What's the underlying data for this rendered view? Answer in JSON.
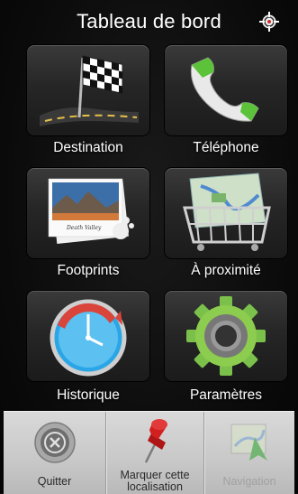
{
  "header": {
    "title": "Tableau de bord",
    "gps_icon": "crosshair-gps-icon"
  },
  "tiles": [
    {
      "label": "Destination",
      "icon": "checkered-flag-road-icon"
    },
    {
      "label": "Téléphone",
      "icon": "phone-handset-icon"
    },
    {
      "label": "Footprints",
      "icon": "photo-stack-icon"
    },
    {
      "label": "À proximité",
      "icon": "map-basket-icon"
    },
    {
      "label": "Historique",
      "icon": "clock-history-icon"
    },
    {
      "label": "Paramètres",
      "icon": "gear-settings-icon"
    }
  ],
  "bottom_bar": {
    "quit_label": "Quitter",
    "mark_label_line1": "Marquer cette",
    "mark_label_line2": "localisation",
    "navigation_label": "Navigation",
    "navigation_enabled": false
  },
  "colors": {
    "phone_green": "#5cc23a",
    "clock_blue": "#2aa6e6",
    "clock_red": "#d9443b",
    "pin_red": "#d21f1f",
    "nav_green": "#3aa83a"
  }
}
